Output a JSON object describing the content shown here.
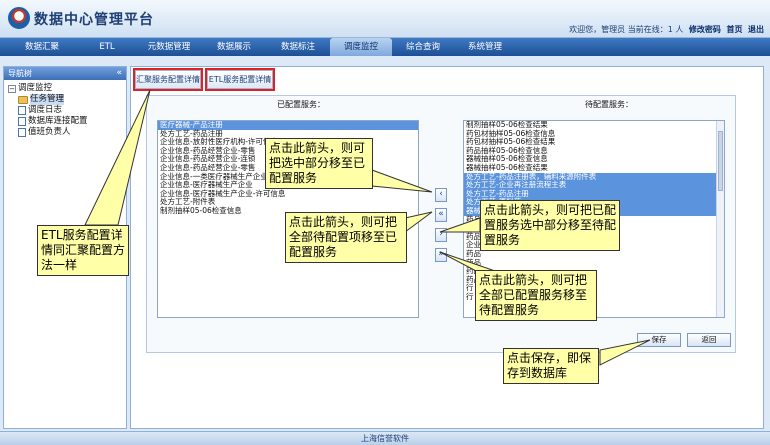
{
  "header": {
    "title": "数据中心管理平台",
    "user_info": "欢迎您，管理员 当前在线：1 人",
    "links": [
      "修改密码",
      "首页",
      "退出"
    ]
  },
  "nav": {
    "items": [
      "数据汇聚",
      "ETL",
      "元数据管理",
      "数据展示",
      "数据标注",
      "调度监控",
      "综合查询",
      "系统管理"
    ],
    "active": "调度监控"
  },
  "sidebar": {
    "title": "导航树",
    "root": "调度监控",
    "items": [
      "任务管理",
      "调度日志",
      "数据库连接配置",
      "值班负责人"
    ],
    "selected": "任务管理"
  },
  "tabs": [
    "汇聚服务配置详情",
    "ETL服务配置详情"
  ],
  "configured": {
    "title": "已配置服务：",
    "options": [
      {
        "label": "医疗器械-产品注册",
        "selected": true
      },
      {
        "label": "处方工艺-药品注册",
        "selected": false
      },
      {
        "label": "企业信息-放射性医疗机构-许可信息",
        "selected": false
      },
      {
        "label": "企业信息-药品经营企业-零售",
        "selected": false
      },
      {
        "label": "企业信息-药品经营企业-连锁",
        "selected": false
      },
      {
        "label": "企业信息-药品经营企业-零售",
        "selected": false
      },
      {
        "label": "企业信息-一类医疗器械生产企业",
        "selected": false
      },
      {
        "label": "企业信息-医疗器械生产企业",
        "selected": false
      },
      {
        "label": "企业信息-医疗器械生产企业-许可信息",
        "selected": false
      },
      {
        "label": "处方工艺-附件表",
        "selected": false
      },
      {
        "label": "制剂抽样05-06检查信息",
        "selected": false
      }
    ]
  },
  "pending": {
    "title": "待配置服务：",
    "options": [
      {
        "label": "制剂抽样05-06检查结果",
        "selected": false
      },
      {
        "label": "药包材抽样05-06检查信息",
        "selected": false
      },
      {
        "label": "药包材抽样05-06检查结果",
        "selected": false
      },
      {
        "label": "药品抽样05-06检查信息",
        "selected": false
      },
      {
        "label": "器械抽样05-06检查信息",
        "selected": false
      },
      {
        "label": "器械抽样05-06检查结果",
        "selected": false
      },
      {
        "label": "处方工艺-药品注册表，辅料来源附件表",
        "selected": true
      },
      {
        "label": "处方工艺-企业再注册流程主表",
        "selected": true
      },
      {
        "label": "处方工艺-药品注册",
        "selected": true
      },
      {
        "label": "处方工艺-原料药",
        "selected": true
      },
      {
        "label": "器械抽样",
        "selected": true
      },
      {
        "label": "药品抽样",
        "selected": false
      },
      {
        "label": "药品注册",
        "selected": false
      },
      {
        "label": "药品生产企业",
        "selected": false
      },
      {
        "label": "企业信息-药品生产企业-许可信息",
        "selected": false
      },
      {
        "label": "药品",
        "selected": false
      },
      {
        "label": "药品",
        "selected": false
      },
      {
        "label": "药品",
        "selected": false
      },
      {
        "label": "药品",
        "selected": false
      },
      {
        "label": "行",
        "selected": false
      },
      {
        "label": "行",
        "selected": false
      }
    ]
  },
  "arrows": [
    "‹",
    "«",
    "›",
    "»"
  ],
  "buttons": {
    "save": "保存",
    "back": "返回"
  },
  "callouts": [
    "ETL服务配置详情同汇聚配置方法一样",
    "点击此箭头，则可把选中部分移至已配置服务",
    "点击此箭头，则可把全部待配置项移至已配置服务",
    "点击此箭头，则可把已配置服务选中部分移至待配置服务",
    "点击此箭头，则可把全部已配置服务移至待配置服务",
    "点击保存，即保存到数据库"
  ],
  "footer": "上海信誉软件"
}
